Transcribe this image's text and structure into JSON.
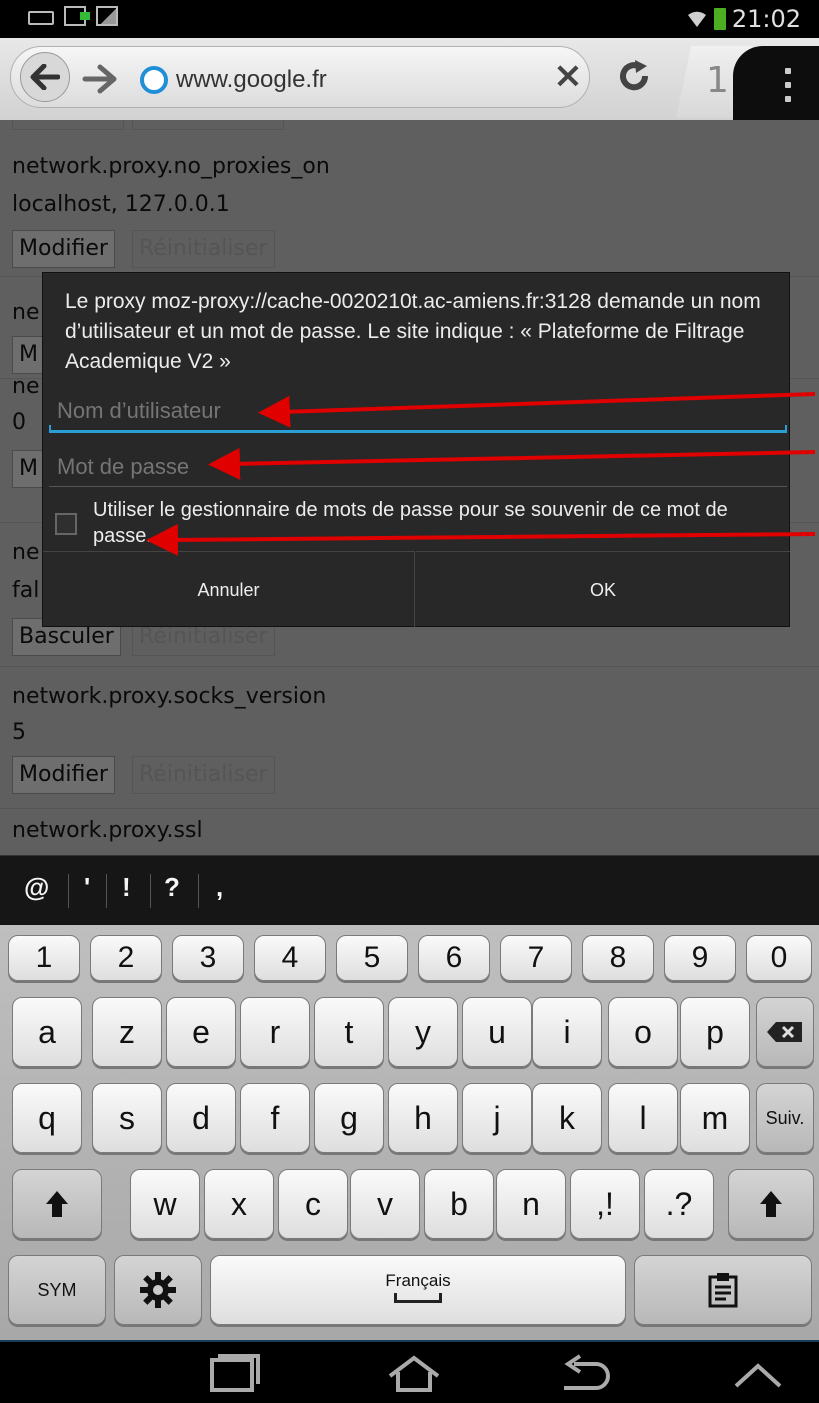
{
  "status_bar": {
    "time": "21:02",
    "icons": [
      "keyboard-icon",
      "usb-icon",
      "image-icon",
      "wifi-icon",
      "battery-icon"
    ]
  },
  "browser": {
    "url": "www.google.fr",
    "tabs_count": "1"
  },
  "page": {
    "prefs": [
      {
        "name": "network.proxy.no_proxies_on",
        "value": "localhost, 127.0.0.1",
        "button1": "Modifier",
        "button2": "Réinitialiser"
      },
      {
        "name": "ne",
        "value": "",
        "button1": "M",
        "button2": ""
      },
      {
        "name": "ne",
        "value": "0",
        "button1": "M",
        "button2": ""
      },
      {
        "name": "ne",
        "value": "fal",
        "button1": "Basculer",
        "button2": "Réinitialiser"
      },
      {
        "name": "network.proxy.socks_version",
        "value": "5",
        "button1": "Modifier",
        "button2": "Réinitialiser"
      },
      {
        "name": "network.proxy.ssl",
        "value": "",
        "button1": "",
        "button2": ""
      }
    ]
  },
  "dialog": {
    "message": "Le proxy moz-proxy://cache-0020210t.ac-amiens.fr:3128 demande un nom d’utilisateur et un mot de passe. Le site indique : « Plateforme de Filtrage Academique V2 »",
    "username_placeholder": "Nom d’utilisateur",
    "password_placeholder": "Mot de passe",
    "remember_label": "Utiliser le gestionnaire de mots de passe pour se souvenir de ce mot de passe.",
    "cancel_label": "Annuler",
    "ok_label": "OK",
    "accent_color": "#2a9fd6",
    "arrow_color": "#e00000"
  },
  "symbol_bar": [
    "@",
    "'",
    "!",
    "?",
    ","
  ],
  "keyboard": {
    "numbers": [
      "1",
      "2",
      "3",
      "4",
      "5",
      "6",
      "7",
      "8",
      "9",
      "0"
    ],
    "row1": [
      "a",
      "z",
      "e",
      "r",
      "t",
      "y",
      "u",
      "i",
      "o",
      "p"
    ],
    "row2": [
      "q",
      "s",
      "d",
      "f",
      "g",
      "h",
      "j",
      "k",
      "l",
      "m"
    ],
    "row3": [
      "w",
      "x",
      "c",
      "v",
      "b",
      "n"
    ],
    "comma_key": ",!",
    "period_key": ".?",
    "next_label": "Suiv.",
    "sym_label": "SYM",
    "space_label": "Français"
  }
}
